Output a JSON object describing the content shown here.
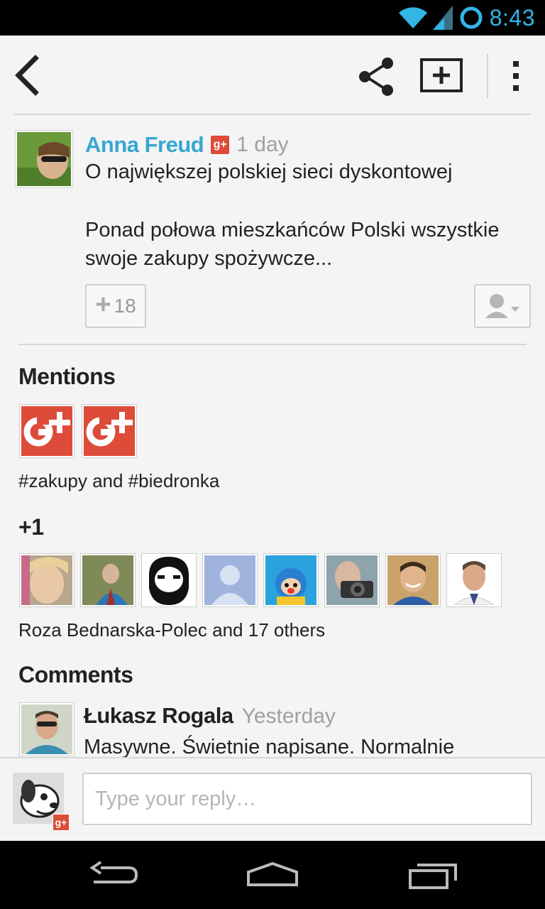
{
  "status_bar": {
    "time": "8:43",
    "accent": "#33b5e5"
  },
  "action_bar": {
    "icons": [
      "back-icon",
      "share-icon",
      "add-to-circle-icon",
      "overflow-menu-icon"
    ]
  },
  "post": {
    "author": "Anna Freud",
    "author_color": "#36a7d1",
    "badge": "g+",
    "time": "1 day",
    "title": "O największej polskiej sieci dyskontowej",
    "body": "Ponad połowa mieszkańców Polski wszystkie swoje zakupy spożywcze...",
    "plus_one_count": "18",
    "plus_one_symbol": "+"
  },
  "mentions": {
    "heading": "Mentions",
    "caption": "#zakupy and #biedronka",
    "icon_text": "g+"
  },
  "plus_ones": {
    "heading": "+1",
    "caption": "Roza Bednarska-Polec and 17 others"
  },
  "comments": {
    "heading": "Comments",
    "items": [
      {
        "author": "Łukasz Rogala",
        "time": "Yesterday",
        "text": "Masywne. Świetnie napisane. Normalnie"
      }
    ]
  },
  "reply": {
    "placeholder": "Type your reply…",
    "badge": "g+"
  },
  "brand_color": "#dd4b39"
}
